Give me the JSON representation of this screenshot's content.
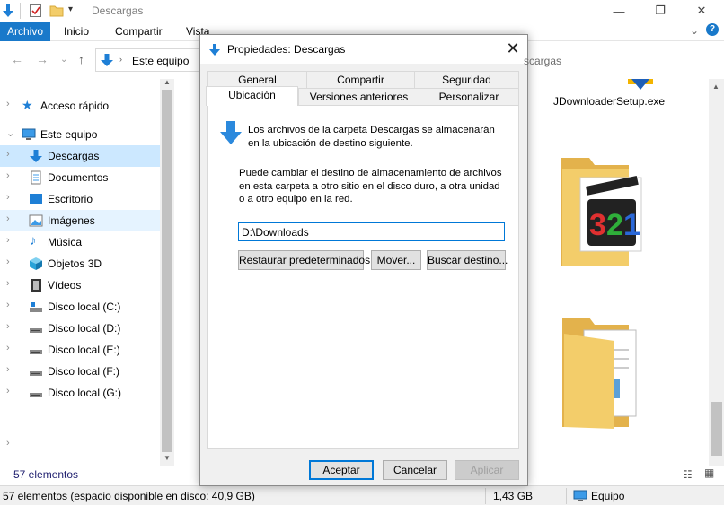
{
  "explorer": {
    "window_title": "Descargas",
    "ribbon_tabs": [
      "Archivo",
      "Inicio",
      "Compartir",
      "Vista"
    ],
    "address_path": "Este equipo",
    "address_tail": "scargas",
    "item_count": "57 elementos",
    "file_name": "JDownloaderSetup.exe",
    "nav": {
      "quick_access": "Acceso rápido",
      "this_pc": "Este equipo",
      "items": [
        "Descargas",
        "Documentos",
        "Escritorio",
        "Imágenes",
        "Música",
        "Objetos 3D",
        "Vídeos",
        "Disco local (C:)",
        "Disco local (D:)",
        "Disco local (E:)",
        "Disco local (F:)",
        "Disco local (G:)"
      ]
    },
    "status": {
      "left": "57 elementos (espacio disponible en disco: 40,9 GB)",
      "size": "1,43 GB",
      "location": "Equipo"
    },
    "colors": {
      "accent": "#1979ca",
      "selection": "#cce8ff",
      "folder": "#f3cd6a",
      "download_arrow": "#1e7fd6"
    }
  },
  "dialog": {
    "title": "Propiedades: Descargas",
    "tabs_row1": [
      "General",
      "Compartir",
      "Seguridad"
    ],
    "tabs_row2": [
      "Ubicación",
      "Versiones anteriores",
      "Personalizar"
    ],
    "active_tab": "Ubicación",
    "description_1": "Los archivos de la carpeta Descargas se almacenarán en la ubicación de destino siguiente.",
    "description_2": "Puede cambiar el destino de almacenamiento de archivos en esta carpeta a otro sitio en el disco duro, a otra unidad o a otro equipo en la red.",
    "path_value": "D:\\Downloads",
    "buttons": {
      "restore": "Restaurar predeterminados",
      "move": "Mover...",
      "find": "Buscar destino...",
      "ok": "Aceptar",
      "cancel": "Cancelar",
      "apply": "Aplicar"
    }
  }
}
